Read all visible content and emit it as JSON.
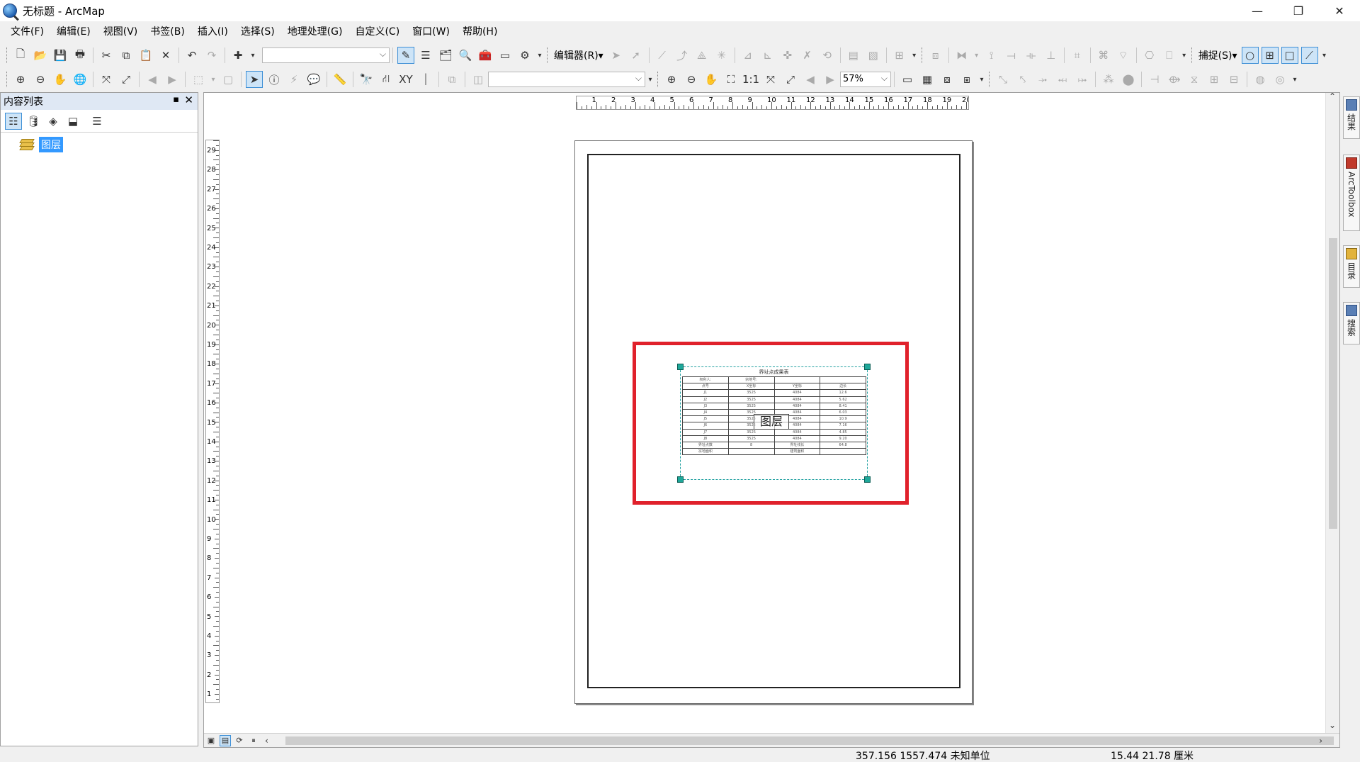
{
  "window": {
    "title": "无标题 - ArcMap",
    "controls": [
      "—",
      "❐",
      "✕"
    ]
  },
  "menu": [
    "文件(F)",
    "编辑(E)",
    "视图(V)",
    "书签(B)",
    "插入(I)",
    "选择(S)",
    "地理处理(G)",
    "自定义(C)",
    "窗口(W)",
    "帮助(H)"
  ],
  "toolbar1": {
    "editor_label": "编辑器(R)▾",
    "snap_label": "捕捉(S)▾",
    "scale_value": ""
  },
  "toolbar2": {
    "zoom_value": "57%"
  },
  "toc": {
    "title": "内容列表",
    "pin": "📌",
    "close": "✕",
    "layer_name": "图层"
  },
  "layout": {
    "ruler_h": [
      "1",
      "2",
      "3",
      "4",
      "5",
      "6",
      "7",
      "8",
      "9",
      "10",
      "11",
      "12",
      "13",
      "14",
      "15",
      "16",
      "17",
      "18",
      "19",
      "20"
    ],
    "ruler_v": [
      "29",
      "28",
      "27",
      "26",
      "25",
      "24",
      "23",
      "22",
      "21",
      "20",
      "19",
      "18",
      "17",
      "16",
      "15",
      "14",
      "13",
      "12",
      "11",
      "10",
      "9",
      "8",
      "7",
      "6",
      "5",
      "4",
      "3",
      "2",
      "1"
    ],
    "element_title": "界址点成果表",
    "element_stamp": "图层",
    "table_rows": [
      [
        "权利人:",
        "宗地号:",
        "",
        ""
      ],
      [
        "点号",
        "X坐标",
        "Y坐标",
        "边长"
      ],
      [
        "J1",
        "3525",
        "4084",
        "12.6"
      ],
      [
        "J2",
        "3525",
        "4084",
        "5.62"
      ],
      [
        "J3",
        "3525",
        "4084",
        "8.41"
      ],
      [
        "J4",
        "3525",
        "4084",
        "6.03"
      ],
      [
        "J5",
        "3525",
        "4084",
        "10.9"
      ],
      [
        "J6",
        "3525",
        "4084",
        "7.16"
      ],
      [
        "J7",
        "3525",
        "4084",
        "4.85"
      ],
      [
        "J8",
        "3525",
        "4084",
        "9.20"
      ],
      [
        "界址点数",
        "8",
        "界址线长",
        "64.8"
      ],
      [
        "宗地面积",
        "",
        "建筑面积",
        ""
      ]
    ]
  },
  "dock": [
    "结果",
    "ArcToolbox",
    "目录",
    "搜索"
  ],
  "status": {
    "coords": "357.156  1557.474 未知单位",
    "page_coords": "15.44  21.78 厘米"
  }
}
